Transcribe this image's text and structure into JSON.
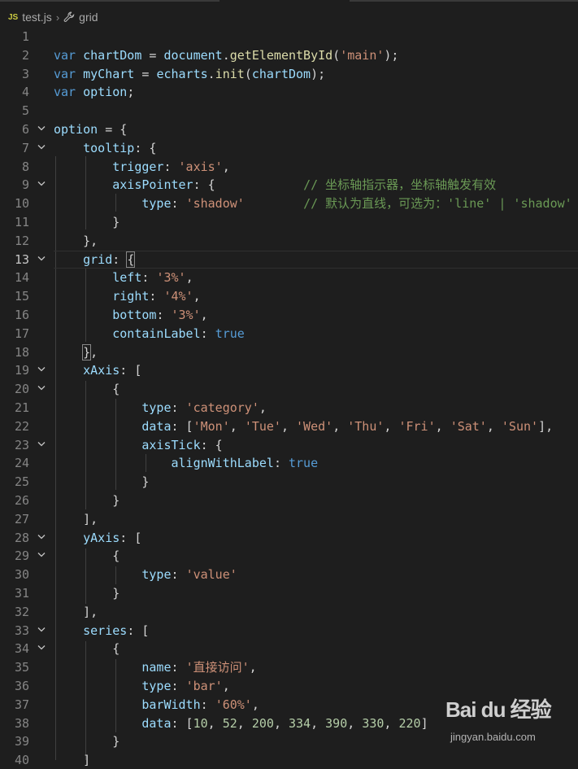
{
  "breadcrumb": {
    "file_badge": "JS",
    "file_name": "test.js",
    "symbol": "grid"
  },
  "editor": {
    "active_line": 13,
    "lines": [
      {
        "n": "1",
        "fold": false,
        "tokens": []
      },
      {
        "n": "2",
        "fold": false,
        "tokens": [
          [
            "kw",
            "var"
          ],
          [
            "pun",
            " "
          ],
          [
            "var",
            "chartDom"
          ],
          [
            "pun",
            " = "
          ],
          [
            "var",
            "document"
          ],
          [
            "pun",
            "."
          ],
          [
            "fn",
            "getElementById"
          ],
          [
            "pun",
            "("
          ],
          [
            "str",
            "'main'"
          ],
          [
            "pun",
            ");"
          ]
        ]
      },
      {
        "n": "3",
        "fold": false,
        "tokens": [
          [
            "kw",
            "var"
          ],
          [
            "pun",
            " "
          ],
          [
            "var",
            "myChart"
          ],
          [
            "pun",
            " = "
          ],
          [
            "var",
            "echarts"
          ],
          [
            "pun",
            "."
          ],
          [
            "fn",
            "init"
          ],
          [
            "pun",
            "("
          ],
          [
            "var",
            "chartDom"
          ],
          [
            "pun",
            ");"
          ]
        ]
      },
      {
        "n": "4",
        "fold": false,
        "tokens": [
          [
            "kw",
            "var"
          ],
          [
            "pun",
            " "
          ],
          [
            "var",
            "option"
          ],
          [
            "pun",
            ";"
          ]
        ]
      },
      {
        "n": "5",
        "fold": false,
        "tokens": []
      },
      {
        "n": "6",
        "fold": true,
        "tokens": [
          [
            "var",
            "option"
          ],
          [
            "pun",
            " = {"
          ]
        ]
      },
      {
        "n": "7",
        "fold": true,
        "tokens": [
          [
            "pun",
            "    "
          ],
          [
            "var",
            "tooltip"
          ],
          [
            "pun",
            ": {"
          ]
        ]
      },
      {
        "n": "8",
        "fold": false,
        "tokens": [
          [
            "pun",
            "        "
          ],
          [
            "var",
            "trigger"
          ],
          [
            "pun",
            ": "
          ],
          [
            "str",
            "'axis'"
          ],
          [
            "pun",
            ","
          ]
        ]
      },
      {
        "n": "9",
        "fold": true,
        "tokens": [
          [
            "pun",
            "        "
          ],
          [
            "var",
            "axisPointer"
          ],
          [
            "pun",
            ": {            "
          ],
          [
            "com",
            "// 坐标轴指示器，坐标轴触发有效"
          ]
        ]
      },
      {
        "n": "10",
        "fold": false,
        "tokens": [
          [
            "pun",
            "            "
          ],
          [
            "var",
            "type"
          ],
          [
            "pun",
            ": "
          ],
          [
            "str",
            "'shadow'"
          ],
          [
            "pun",
            "        "
          ],
          [
            "com",
            "// 默认为直线，可选为：'line' | 'shadow'"
          ]
        ]
      },
      {
        "n": "11",
        "fold": false,
        "tokens": [
          [
            "pun",
            "        }"
          ]
        ]
      },
      {
        "n": "12",
        "fold": false,
        "tokens": [
          [
            "pun",
            "    },"
          ]
        ]
      },
      {
        "n": "13",
        "fold": true,
        "tokens": [
          [
            "pun",
            "    "
          ],
          [
            "var",
            "grid"
          ],
          [
            "pun",
            ": "
          ],
          [
            "brk",
            "{"
          ]
        ]
      },
      {
        "n": "14",
        "fold": false,
        "tokens": [
          [
            "pun",
            "        "
          ],
          [
            "var",
            "left"
          ],
          [
            "pun",
            ": "
          ],
          [
            "str",
            "'3%'"
          ],
          [
            "pun",
            ","
          ]
        ]
      },
      {
        "n": "15",
        "fold": false,
        "tokens": [
          [
            "pun",
            "        "
          ],
          [
            "var",
            "right"
          ],
          [
            "pun",
            ": "
          ],
          [
            "str",
            "'4%'"
          ],
          [
            "pun",
            ","
          ]
        ]
      },
      {
        "n": "16",
        "fold": false,
        "tokens": [
          [
            "pun",
            "        "
          ],
          [
            "var",
            "bottom"
          ],
          [
            "pun",
            ": "
          ],
          [
            "str",
            "'3%'"
          ],
          [
            "pun",
            ","
          ]
        ]
      },
      {
        "n": "17",
        "fold": false,
        "tokens": [
          [
            "pun",
            "        "
          ],
          [
            "var",
            "containLabel"
          ],
          [
            "pun",
            ": "
          ],
          [
            "kw",
            "true"
          ]
        ]
      },
      {
        "n": "18",
        "fold": false,
        "tokens": [
          [
            "pun",
            "    "
          ],
          [
            "brk",
            "}"
          ],
          [
            "pun",
            ","
          ]
        ]
      },
      {
        "n": "19",
        "fold": true,
        "tokens": [
          [
            "pun",
            "    "
          ],
          [
            "var",
            "xAxis"
          ],
          [
            "pun",
            ": ["
          ]
        ]
      },
      {
        "n": "20",
        "fold": true,
        "tokens": [
          [
            "pun",
            "        {"
          ]
        ]
      },
      {
        "n": "21",
        "fold": false,
        "tokens": [
          [
            "pun",
            "            "
          ],
          [
            "var",
            "type"
          ],
          [
            "pun",
            ": "
          ],
          [
            "str",
            "'category'"
          ],
          [
            "pun",
            ","
          ]
        ]
      },
      {
        "n": "22",
        "fold": false,
        "tokens": [
          [
            "pun",
            "            "
          ],
          [
            "var",
            "data"
          ],
          [
            "pun",
            ": ["
          ],
          [
            "str",
            "'Mon'"
          ],
          [
            "pun",
            ", "
          ],
          [
            "str",
            "'Tue'"
          ],
          [
            "pun",
            ", "
          ],
          [
            "str",
            "'Wed'"
          ],
          [
            "pun",
            ", "
          ],
          [
            "str",
            "'Thu'"
          ],
          [
            "pun",
            ", "
          ],
          [
            "str",
            "'Fri'"
          ],
          [
            "pun",
            ", "
          ],
          [
            "str",
            "'Sat'"
          ],
          [
            "pun",
            ", "
          ],
          [
            "str",
            "'Sun'"
          ],
          [
            "pun",
            "],"
          ]
        ]
      },
      {
        "n": "23",
        "fold": true,
        "tokens": [
          [
            "pun",
            "            "
          ],
          [
            "var",
            "axisTick"
          ],
          [
            "pun",
            ": {"
          ]
        ]
      },
      {
        "n": "24",
        "fold": false,
        "tokens": [
          [
            "pun",
            "                "
          ],
          [
            "var",
            "alignWithLabel"
          ],
          [
            "pun",
            ": "
          ],
          [
            "kw",
            "true"
          ]
        ]
      },
      {
        "n": "25",
        "fold": false,
        "tokens": [
          [
            "pun",
            "            }"
          ]
        ]
      },
      {
        "n": "26",
        "fold": false,
        "tokens": [
          [
            "pun",
            "        }"
          ]
        ]
      },
      {
        "n": "27",
        "fold": false,
        "tokens": [
          [
            "pun",
            "    ],"
          ]
        ]
      },
      {
        "n": "28",
        "fold": true,
        "tokens": [
          [
            "pun",
            "    "
          ],
          [
            "var",
            "yAxis"
          ],
          [
            "pun",
            ": ["
          ]
        ]
      },
      {
        "n": "29",
        "fold": true,
        "tokens": [
          [
            "pun",
            "        {"
          ]
        ]
      },
      {
        "n": "30",
        "fold": false,
        "tokens": [
          [
            "pun",
            "            "
          ],
          [
            "var",
            "type"
          ],
          [
            "pun",
            ": "
          ],
          [
            "str",
            "'value'"
          ]
        ]
      },
      {
        "n": "31",
        "fold": false,
        "tokens": [
          [
            "pun",
            "        }"
          ]
        ]
      },
      {
        "n": "32",
        "fold": false,
        "tokens": [
          [
            "pun",
            "    ],"
          ]
        ]
      },
      {
        "n": "33",
        "fold": true,
        "tokens": [
          [
            "pun",
            "    "
          ],
          [
            "var",
            "series"
          ],
          [
            "pun",
            ": ["
          ]
        ]
      },
      {
        "n": "34",
        "fold": true,
        "tokens": [
          [
            "pun",
            "        {"
          ]
        ]
      },
      {
        "n": "35",
        "fold": false,
        "tokens": [
          [
            "pun",
            "            "
          ],
          [
            "var",
            "name"
          ],
          [
            "pun",
            ": "
          ],
          [
            "str",
            "'直接访问'"
          ],
          [
            "pun",
            ","
          ]
        ]
      },
      {
        "n": "36",
        "fold": false,
        "tokens": [
          [
            "pun",
            "            "
          ],
          [
            "var",
            "type"
          ],
          [
            "pun",
            ": "
          ],
          [
            "str",
            "'bar'"
          ],
          [
            "pun",
            ","
          ]
        ]
      },
      {
        "n": "37",
        "fold": false,
        "tokens": [
          [
            "pun",
            "            "
          ],
          [
            "var",
            "barWidth"
          ],
          [
            "pun",
            ": "
          ],
          [
            "str",
            "'60%'"
          ],
          [
            "pun",
            ","
          ]
        ]
      },
      {
        "n": "38",
        "fold": false,
        "tokens": [
          [
            "pun",
            "            "
          ],
          [
            "var",
            "data"
          ],
          [
            "pun",
            ": ["
          ],
          [
            "num",
            "10"
          ],
          [
            "pun",
            ", "
          ],
          [
            "num",
            "52"
          ],
          [
            "pun",
            ", "
          ],
          [
            "num",
            "200"
          ],
          [
            "pun",
            ", "
          ],
          [
            "num",
            "334"
          ],
          [
            "pun",
            ", "
          ],
          [
            "num",
            "390"
          ],
          [
            "pun",
            ", "
          ],
          [
            "num",
            "330"
          ],
          [
            "pun",
            ", "
          ],
          [
            "num",
            "220"
          ],
          [
            "pun",
            "]"
          ]
        ]
      },
      {
        "n": "39",
        "fold": false,
        "tokens": [
          [
            "pun",
            "        }"
          ]
        ]
      },
      {
        "n": "40",
        "fold": false,
        "tokens": [
          [
            "pun",
            "    ]"
          ]
        ]
      }
    ]
  },
  "watermark": {
    "logo_text": "Bai du 经验",
    "sub_text": "jingyan.baidu.com"
  },
  "colors": {
    "background": "#1e1e1e",
    "keyword": "#569cd6",
    "variable": "#9cdcfe",
    "function": "#dcdcaa",
    "string": "#ce9178",
    "number": "#b5cea8",
    "comment": "#6a9955"
  }
}
